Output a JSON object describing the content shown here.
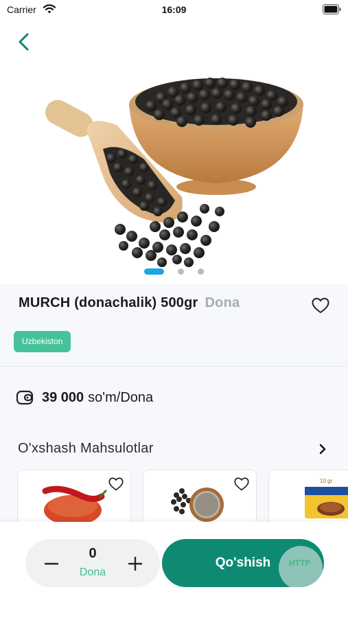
{
  "status_bar": {
    "carrier": "Carrier",
    "time": "16:09"
  },
  "product": {
    "title": "MURCH (donachalik) 500gr",
    "unit": "Dona",
    "origin_badge": "Uzbekiston",
    "price_amount": "39 000",
    "price_unit": "so'm/Dona",
    "image_icon": "black-pepper-bowl-photo",
    "carousel": {
      "count": 3,
      "active_index": 0
    }
  },
  "similar": {
    "header": "O'xshash Mahsulotlar",
    "items": [
      {
        "image": "red-chili-powder-photo"
      },
      {
        "image": "ground-black-pepper-photo"
      },
      {
        "image": "seasoning-box-photo",
        "visible_text": "10 gr"
      }
    ]
  },
  "cart": {
    "quantity": "0",
    "quantity_unit": "Dona",
    "add_label": "Qo'shish",
    "debug_badge": "HTTP"
  },
  "colors": {
    "primary": "#0e8a73",
    "badge_green": "#46c29b",
    "active_dot": "#1aa5e6",
    "back_arrow": "#12806b"
  }
}
